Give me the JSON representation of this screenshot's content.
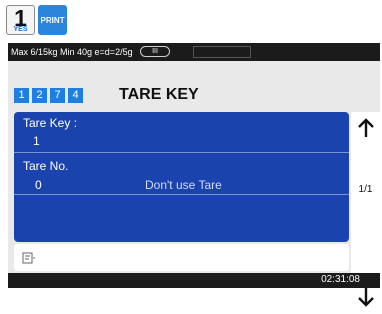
{
  "hardware_keys": {
    "key1": {
      "label": "1",
      "sub_label": "YES"
    },
    "print": {
      "label": "PRINT"
    }
  },
  "status_bar": {
    "spec_text": "Max 6/15kg Min 40g e=d=2/5g",
    "class_badge": "III"
  },
  "header": {
    "code_digits": [
      "1",
      "2",
      "7",
      "4"
    ],
    "title": "TARE KEY"
  },
  "form": {
    "tare_key_label": "Tare Key :",
    "tare_key_value": "1",
    "tare_no_label": "Tare No.",
    "tare_no_value": "0",
    "tare_no_desc": "Don't use Tare"
  },
  "pager": {
    "up_icon": "arrow-up-icon",
    "page_indicator": "1/1",
    "down_icon": "arrow-down-icon"
  },
  "input": {
    "icon": "memo-icon",
    "value": ""
  },
  "footer": {
    "time": "02:31:08"
  },
  "colors": {
    "panel_blue": "#1b43ad",
    "code_blue": "#1f7fe0",
    "print_blue": "#2a86dc",
    "bar_dark": "#1b1b1b"
  }
}
